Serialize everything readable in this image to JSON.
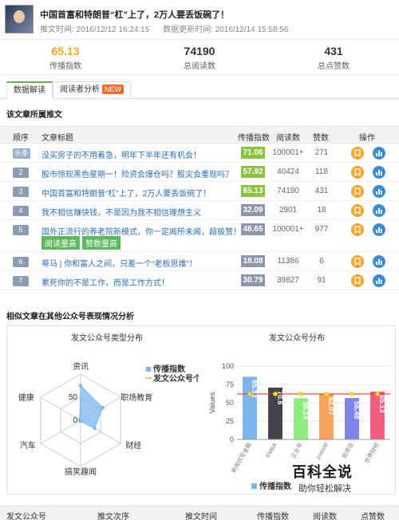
{
  "article": {
    "title": "中国首富和特朗普“杠”上了，2万人要丢饭碗了！",
    "publish_time": "推文时间: 2016/12/12 16:24:15",
    "update_time": "数据更新时间: 2016/12/14 15:58:56"
  },
  "stats": [
    {
      "value": "65.13",
      "label": "传播指数"
    },
    {
      "value": "74190",
      "label": "总阅读数"
    },
    {
      "value": "431",
      "label": "总点赞数"
    }
  ],
  "tabs": [
    {
      "label": "数据解读"
    },
    {
      "label": "阅读者分析",
      "badge": "NEW"
    }
  ],
  "section1_title": "该文章所属推文",
  "table": {
    "headers": [
      "顺序",
      "文章标题",
      "传播指数",
      "阅读数",
      "赞数",
      "操作"
    ],
    "rows": [
      {
        "idx": "头条",
        "title": "没买房子的不用着急，明年下半年还有机会！",
        "score": "71.06",
        "reads": "100001+",
        "likes": "271",
        "tone": "green"
      },
      {
        "idx": "2",
        "title": "股市惊现黑色星期一！险资会爆仓吗？股灾会重现吗？",
        "score": "57.92",
        "reads": "40424",
        "likes": "118",
        "tone": "green"
      },
      {
        "idx": "3",
        "title": "中国首富和特朗普“杠”上了，2万人要丢饭碗了！",
        "score": "65.13",
        "reads": "74190",
        "likes": "431",
        "tone": "green"
      },
      {
        "idx": "4",
        "title": "我不相信赚快钱，不是因为我不相信理想主义",
        "score": "32.09",
        "reads": "2901",
        "likes": "18",
        "tone": "gray"
      },
      {
        "idx": "5",
        "title": "国外正流行的养老院新模式，你一定闻所未闻，超极赞！",
        "score": "48.65",
        "reads": "100001+",
        "likes": "977",
        "tone": "gray",
        "tags": [
          "阅读量高",
          "赞数量高"
        ]
      },
      {
        "idx": "6",
        "title": "蒂马 | 你和富人之间，只差一个“老板思维”！",
        "score": "18.08",
        "reads": "11386",
        "likes": "6",
        "tone": "gray"
      },
      {
        "idx": "7",
        "title": "累死你的不是工作，而是工作方式！",
        "score": "30.79",
        "reads": "39827",
        "likes": "91",
        "tone": "gray"
      }
    ]
  },
  "section2_title": "相似文章在其他公众号表现情况分析",
  "radar": {
    "title": "发文公众号类型分布",
    "axes": [
      "资讯",
      "职场教育",
      "财经",
      "搞笑趣闻",
      "汽车",
      "健康"
    ],
    "tick_labels": [
      "50",
      "0"
    ],
    "legend": [
      "传播指数",
      "发文公众号个"
    ],
    "values": [
      0.75,
      0.55,
      0.35,
      0.0,
      0.0,
      0.0
    ]
  },
  "chart_data": {
    "type": "bar",
    "title": "发文公众号分布",
    "ylabel": "Values",
    "ylim": [
      0,
      100
    ],
    "yticks": [
      "100",
      "75",
      "50",
      "25",
      "0"
    ],
    "categories": [
      "新闻代写金融",
      "EMBA",
      "企业号",
      "jnworld",
      "投资信",
      "世界财经"
    ],
    "values": [
      85.52,
      70.68,
      56.14,
      62.07,
      56.48,
      65.13
    ],
    "value_labels": [
      "85.52",
      "70.6",
      "56.14",
      "62.07",
      "56.48",
      "65.13"
    ],
    "bar_colors": [
      "#7cb5ec",
      "#434348",
      "#90ed7d",
      "#f7a35c",
      "#8085e9",
      "#f15c80"
    ],
    "line_series_values": [
      62,
      62,
      62,
      62,
      62,
      62
    ],
    "legend": [
      "传播指数"
    ]
  },
  "bottom_headers": [
    "发文公众号",
    "推文次序",
    "推文时间",
    "传播指数",
    "阅读数",
    "点赞数"
  ],
  "watermark": {
    "main": "百科全说",
    "sub": "助你轻松解决"
  },
  "colors": {
    "accent_green": "#8ac43f",
    "accent_orange": "#f5a623",
    "link_blue": "#2a6db4"
  }
}
